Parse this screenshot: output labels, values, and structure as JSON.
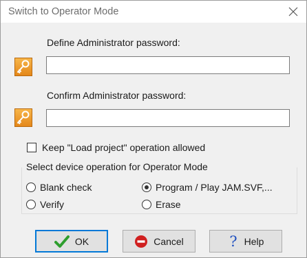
{
  "dialog": {
    "title": "Switch to Operator Mode",
    "close_icon": "close-icon"
  },
  "password": {
    "define_label": "Define Administrator password:",
    "define_value": "",
    "confirm_label": "Confirm Administrator password:",
    "confirm_value": "",
    "key_icon": "key-icon",
    "key_icon_color": "#f0a030"
  },
  "keep_load": {
    "label": "Keep \"Load project\" operation allowed",
    "checked": false
  },
  "operation_group": {
    "title": "Select device operation for Operator Mode",
    "options": [
      {
        "label": "Blank check",
        "selected": false
      },
      {
        "label": "Program / Play JAM.SVF,...",
        "selected": true
      },
      {
        "label": "Verify",
        "selected": false
      },
      {
        "label": "Erase",
        "selected": false
      }
    ]
  },
  "buttons": {
    "ok": {
      "label": "OK",
      "icon": "checkmark-icon",
      "color": "#2e9e2e"
    },
    "cancel": {
      "label": "Cancel",
      "icon": "no-entry-icon",
      "color": "#d02020"
    },
    "help": {
      "label": "Help",
      "icon": "question-icon",
      "color": "#2050c0"
    }
  }
}
